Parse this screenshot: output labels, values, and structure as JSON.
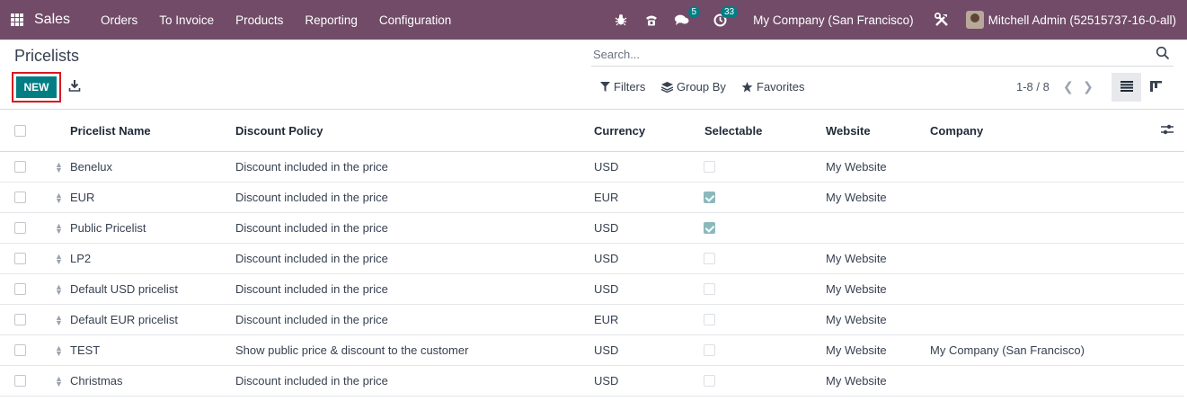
{
  "navbar": {
    "app_name": "Sales",
    "menu": [
      "Orders",
      "To Invoice",
      "Products",
      "Reporting",
      "Configuration"
    ],
    "messages_badge": "5",
    "activities_badge": "33",
    "company": "My Company (San Francisco)",
    "user": "Mitchell Admin (52515737-16-0-all)"
  },
  "control_panel": {
    "title": "Pricelists",
    "new_label": "NEW",
    "search_placeholder": "Search...",
    "filters_label": "Filters",
    "group_by_label": "Group By",
    "favorites_label": "Favorites",
    "pager": "1-8 / 8"
  },
  "table": {
    "columns": [
      "Pricelist Name",
      "Discount Policy",
      "Currency",
      "Selectable",
      "Website",
      "Company"
    ],
    "rows": [
      {
        "name": "Benelux",
        "policy": "Discount included in the price",
        "currency": "USD",
        "selectable": false,
        "website": "My Website",
        "company": ""
      },
      {
        "name": "EUR",
        "policy": "Discount included in the price",
        "currency": "EUR",
        "selectable": true,
        "website": "My Website",
        "company": ""
      },
      {
        "name": "Public Pricelist",
        "policy": "Discount included in the price",
        "currency": "USD",
        "selectable": true,
        "website": "",
        "company": ""
      },
      {
        "name": "LP2",
        "policy": "Discount included in the price",
        "currency": "USD",
        "selectable": false,
        "website": "My Website",
        "company": ""
      },
      {
        "name": "Default USD pricelist",
        "policy": "Discount included in the price",
        "currency": "USD",
        "selectable": false,
        "website": "My Website",
        "company": ""
      },
      {
        "name": "Default EUR pricelist",
        "policy": "Discount included in the price",
        "currency": "EUR",
        "selectable": false,
        "website": "My Website",
        "company": ""
      },
      {
        "name": "TEST",
        "policy": "Show public price & discount to the customer",
        "currency": "USD",
        "selectable": false,
        "website": "My Website",
        "company": "My Company (San Francisco)"
      },
      {
        "name": "Christmas",
        "policy": "Discount included in the price",
        "currency": "USD",
        "selectable": false,
        "website": "My Website",
        "company": ""
      }
    ]
  },
  "colors": {
    "navbar": "#714B67",
    "primary": "#017E84",
    "highlight_frame": "#d71920"
  }
}
